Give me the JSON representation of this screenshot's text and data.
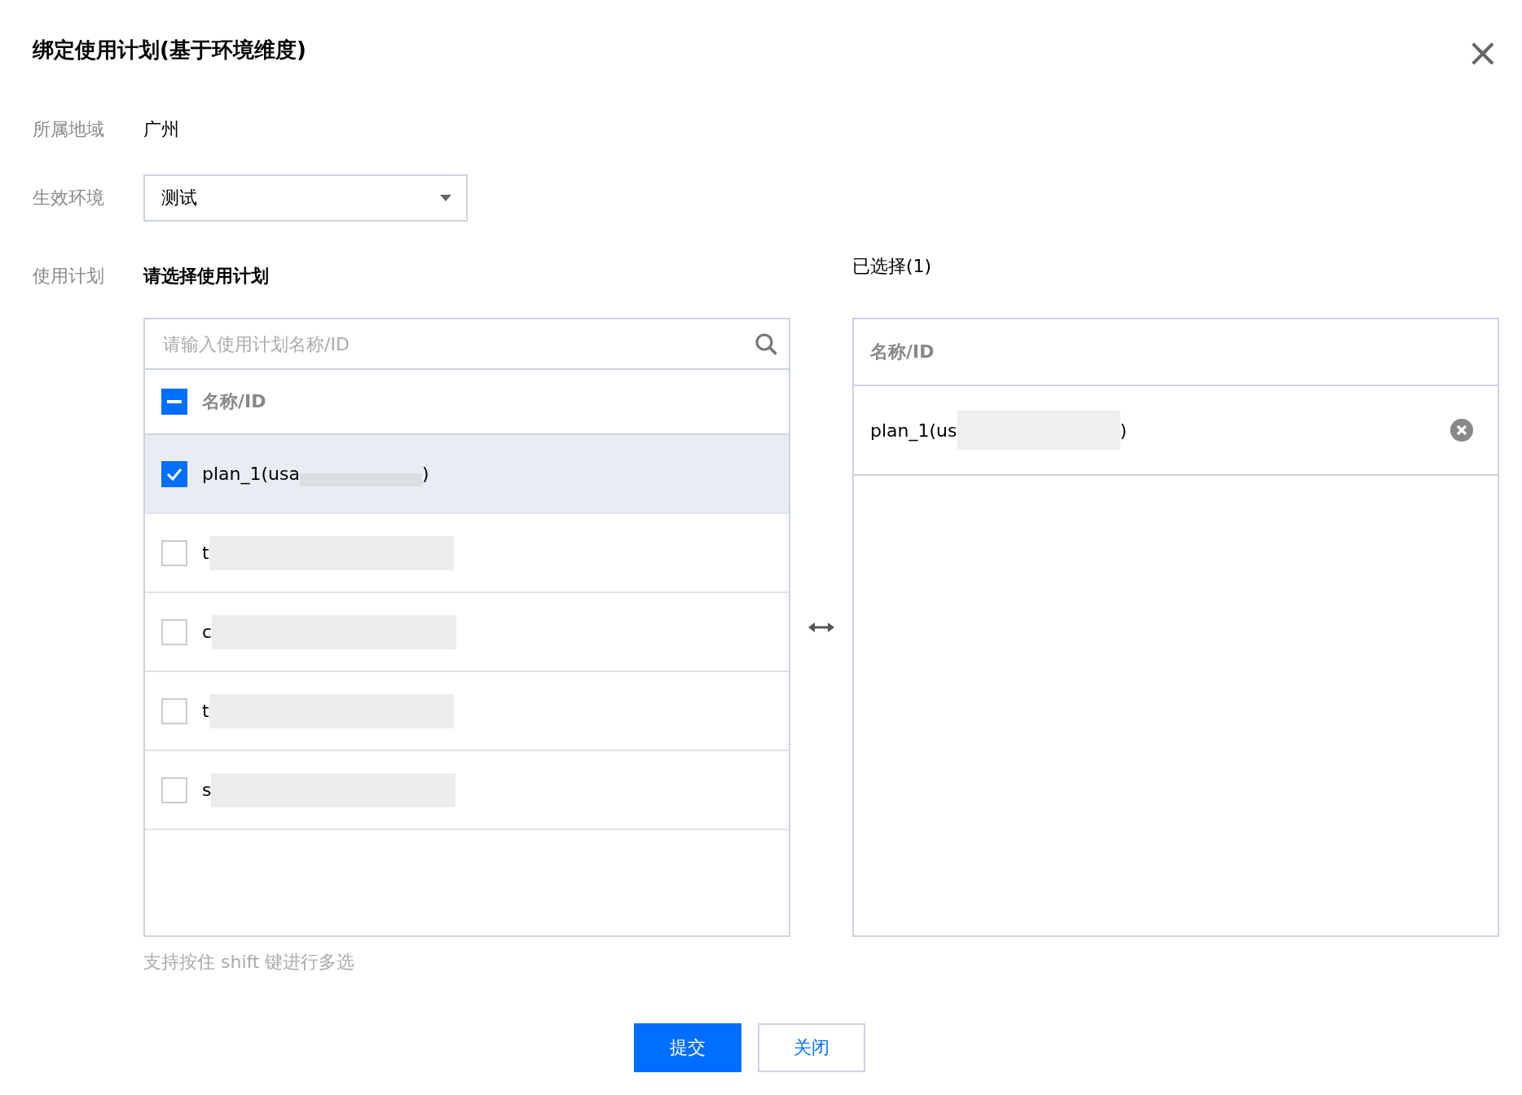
{
  "dialog": {
    "title": "绑定使用计划(基于环境维度)",
    "close_icon": "×"
  },
  "region": {
    "label": "所属地域",
    "value": "广州"
  },
  "environment": {
    "label": "生效环境",
    "value": "测试"
  },
  "plan": {
    "label": "使用计划",
    "heading": "请选择使用计划",
    "selected_heading": "已选择(1)"
  },
  "source": {
    "search_placeholder": "请输入使用计划名称/ID",
    "header": {
      "label": "名称/ID",
      "indeterminate": true
    },
    "items": [
      {
        "name_start": "plan_1(usa",
        "name_end": ")",
        "checked": true,
        "selected": true
      },
      {
        "name_start": "t",
        "checked": false,
        "selected": false
      },
      {
        "name_start": "c",
        "checked": false,
        "selected": false
      },
      {
        "name_start": "t",
        "checked": false,
        "selected": false
      },
      {
        "name_start": "s",
        "checked": false,
        "selected": false
      }
    ]
  },
  "target": {
    "header": "名称/ID",
    "items": [
      {
        "name_start": "plan_1(us",
        "name_end": ")"
      }
    ]
  },
  "hint": "支持按住 shift 键进行多选",
  "buttons": [
    {
      "label": "提交",
      "kind": "primary"
    },
    {
      "label": "关闭",
      "kind": "secondary"
    }
  ]
}
